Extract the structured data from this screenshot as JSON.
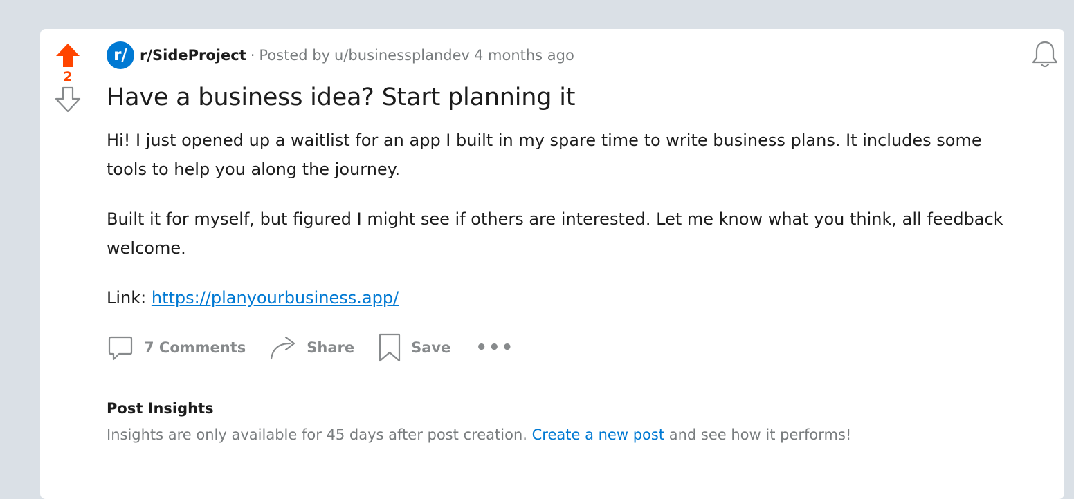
{
  "post": {
    "score": "2",
    "subreddit_icon_text": "r/",
    "subreddit": "r/SideProject",
    "separator": "·",
    "posted_by_label": "Posted by",
    "author": "u/businessplandev",
    "time_ago": "4 months ago",
    "title": "Have a business idea? Start planning it",
    "paragraph1": "Hi! I just opened up a waitlist for an app I built in my spare time to write business plans. It includes some tools to help you along the journey.",
    "paragraph2": "Built it for myself, but figured I might see if others are interested. Let me know what you think, all feedback welcome.",
    "link_label": "Link: ",
    "link_url": "https://planyourbusiness.app/"
  },
  "actions": {
    "comments_label": "7 Comments",
    "share_label": "Share",
    "save_label": "Save",
    "more_label": "•••"
  },
  "insights": {
    "title": "Post Insights",
    "text_before": "Insights are only available for 45 days after post creation. ",
    "link_text": "Create a new post",
    "text_after": " and see how it performs!"
  },
  "icons": {
    "upvote": "upvote-arrow-filled",
    "downvote": "downvote-arrow-outline",
    "comment": "comment-bubble",
    "share": "share-arrow",
    "save": "bookmark",
    "bell": "notification-bell"
  },
  "colors": {
    "upvote": "#ff4500",
    "link": "#0079d3",
    "subreddit_icon_bg": "#0079d3",
    "muted": "#787c7e",
    "page_bg": "#dae0e6"
  }
}
